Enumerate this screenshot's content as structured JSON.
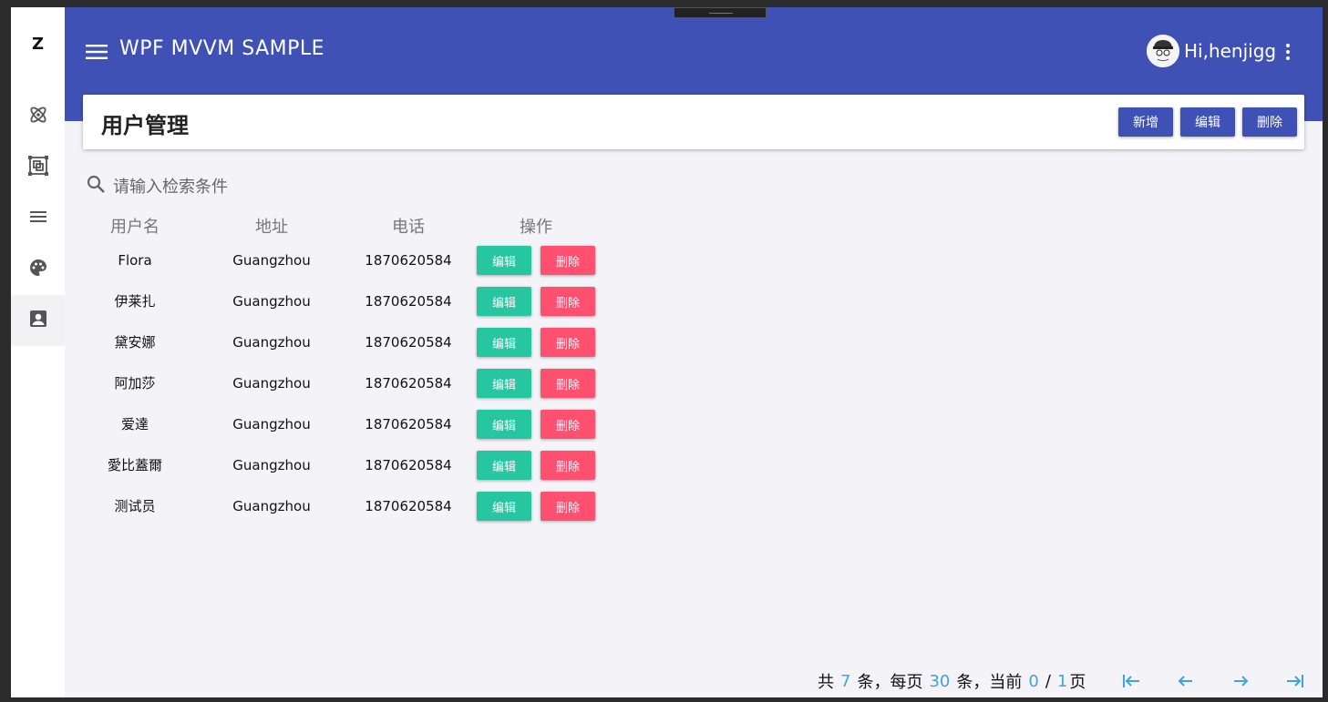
{
  "app": {
    "logo": "Z",
    "title": "WPF MVVM SAMPLE",
    "greeting": "Hi,henjigg"
  },
  "sidebar": {
    "items": [
      {
        "icon": "atom-icon"
      },
      {
        "icon": "selection-icon"
      },
      {
        "icon": "menu-lines-icon"
      },
      {
        "icon": "palette-icon"
      },
      {
        "icon": "account-box-icon",
        "active": true
      }
    ]
  },
  "page": {
    "title": "用户管理",
    "buttons": {
      "add": "新增",
      "edit": "编辑",
      "delete": "删除"
    }
  },
  "search": {
    "placeholder": "请输入检索条件"
  },
  "table": {
    "headers": [
      "用户名",
      "地址",
      "电话",
      "操作"
    ],
    "rows": [
      {
        "name": "Flora",
        "address": "Guangzhou",
        "phone": "1870620584"
      },
      {
        "name": "伊莱扎",
        "address": "Guangzhou",
        "phone": "1870620584"
      },
      {
        "name": "黛安娜",
        "address": "Guangzhou",
        "phone": "1870620584"
      },
      {
        "name": "阿加莎",
        "address": "Guangzhou",
        "phone": "1870620584"
      },
      {
        "name": "爱達",
        "address": "Guangzhou",
        "phone": "1870620584"
      },
      {
        "name": "愛比蓋爾",
        "address": "Guangzhou",
        "phone": "1870620584"
      },
      {
        "name": "测试员",
        "address": "Guangzhou",
        "phone": "1870620584"
      }
    ],
    "row_edit_label": "编辑",
    "row_delete_label": "删除"
  },
  "pager": {
    "total_prefix": "共",
    "total": "7",
    "per_page_prefix": "条，每页",
    "per_page": "30",
    "current_prefix": "条，当前",
    "current": "0",
    "slash": "/",
    "pages": "1",
    "pages_suffix": "页"
  },
  "colors": {
    "primary": "#3f51b5",
    "edit": "#26c6a0",
    "delete": "#ff5070",
    "pager_accent": "#3ea3e0"
  }
}
